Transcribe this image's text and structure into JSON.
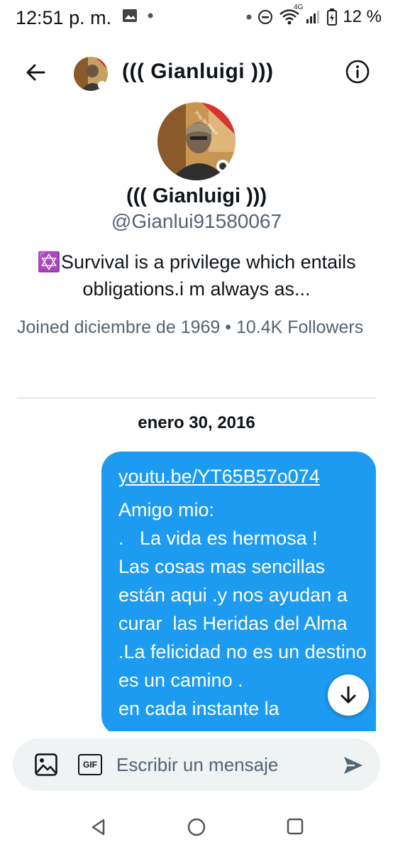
{
  "status_bar": {
    "time": "12:51 p. m.",
    "network_label": "4G",
    "battery": "12 %"
  },
  "header": {
    "title": "((( Gianluigi )))"
  },
  "profile": {
    "name": "((( Gianluigi )))",
    "handle": "@Gianlui91580067",
    "bio": "✡️Survival is a privilege which entails obligations.i m always as...",
    "meta": "Joined diciembre de 1969 • 10.4K Followers",
    "avatar_badge": "Pray for Peace"
  },
  "conversation": {
    "date": "enero 30, 2016",
    "message_link": "youtu.be/YT65B57o074",
    "message_text": "Amigo mio:\n.   La vida es hermosa !\nLas cosas mas sencillas están aqui .y nos ayudan a curar  las Heridas del Alma .La felicidad no es un destino es un camino .\nen cada instante la"
  },
  "composer": {
    "placeholder": "Escribir un mensaje",
    "gif_label": "GIF"
  },
  "colors": {
    "accent": "#1d9bf0",
    "text_secondary": "#536471",
    "composer_bg": "#eff3f4"
  }
}
